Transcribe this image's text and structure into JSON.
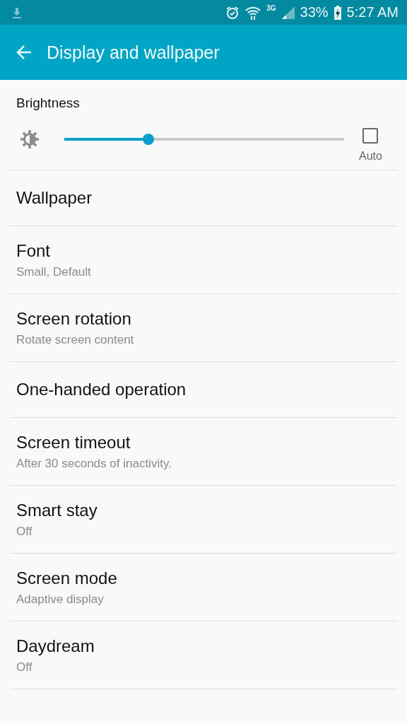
{
  "status_bar": {
    "network": "3G",
    "battery": "33%",
    "time": "5:27 AM"
  },
  "app_bar": {
    "title": "Display and wallpaper"
  },
  "brightness": {
    "label": "Brightness",
    "level": 0.3,
    "auto": {
      "label": "Auto",
      "checked": false
    }
  },
  "settings": [
    {
      "title": "Wallpaper"
    },
    {
      "title": "Font",
      "subtitle": "Small, Default"
    },
    {
      "title": "Screen rotation",
      "subtitle": "Rotate screen content"
    },
    {
      "title": "One-handed operation"
    },
    {
      "title": "Screen timeout",
      "subtitle": "After 30 seconds of inactivity."
    },
    {
      "title": "Smart stay",
      "subtitle": "Off"
    },
    {
      "title": "Screen mode",
      "subtitle": "Adaptive display"
    },
    {
      "title": "Daydream",
      "subtitle": "Off"
    }
  ]
}
